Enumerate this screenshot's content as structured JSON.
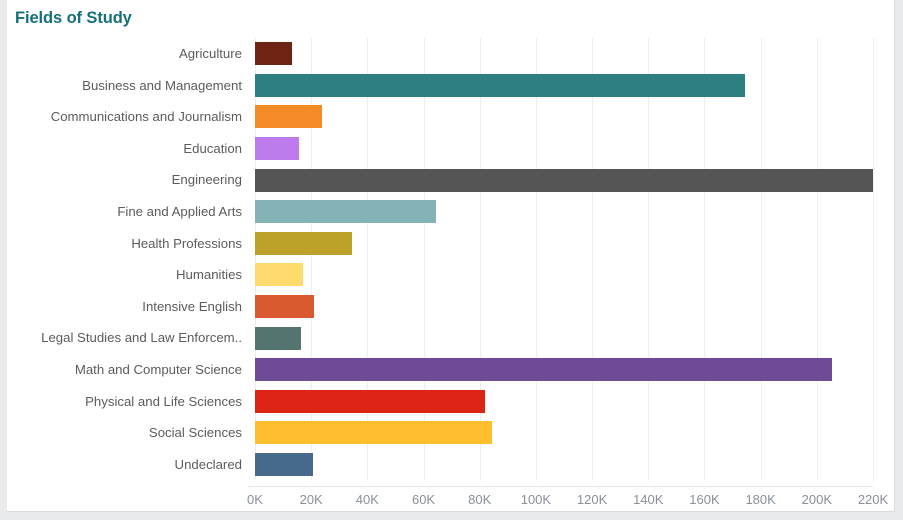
{
  "chart": {
    "title": "Fields of Study",
    "title_color": "#15707a",
    "background": "#ffffff",
    "page_background": "#e9eaec",
    "label_color": "#5c5c5c",
    "tick_color": "#8a9099",
    "gridline_color": "#eceded"
  },
  "chart_data": {
    "type": "bar",
    "orientation": "horizontal",
    "title": "Fields of Study",
    "xlabel": "",
    "ylabel": "",
    "xlim": [
      0,
      220000
    ],
    "xtick_labels": [
      "0K",
      "20K",
      "40K",
      "60K",
      "80K",
      "100K",
      "120K",
      "140K",
      "160K",
      "180K",
      "200K",
      "220K"
    ],
    "xtick_values": [
      0,
      20000,
      40000,
      60000,
      80000,
      100000,
      120000,
      140000,
      160000,
      180000,
      200000,
      220000
    ],
    "grid": true,
    "grid_axis": "x",
    "legend": false,
    "categories": [
      "Agriculture",
      "Business and Management",
      "Communications and Journalism",
      "Education",
      "Engineering",
      "Fine and Applied Arts",
      "Health Professions",
      "Humanities",
      "Intensive English",
      "Legal Studies and Law Enforcem..",
      "Math and Computer Science",
      "Physical and Life Sciences",
      "Social Sciences",
      "Undeclared"
    ],
    "values": [
      13000,
      174500,
      24000,
      15500,
      220000,
      64500,
      34500,
      17000,
      21000,
      16500,
      205500,
      82000,
      84500,
      20500
    ],
    "colors": [
      "#6d2413",
      "#2d7f82",
      "#f38b26",
      "#bd7beb",
      "#555555",
      "#85b2b6",
      "#bda028",
      "#ffdb6d",
      "#d95a30",
      "#54756f",
      "#6f4a95",
      "#dc2515",
      "#ffbe2e",
      "#47698c"
    ],
    "bars": [
      {
        "category": "Agriculture",
        "value": 13000,
        "color": "#6d2413"
      },
      {
        "category": "Business and Management",
        "value": 174500,
        "color": "#2d7f82"
      },
      {
        "category": "Communications and Journalism",
        "value": 24000,
        "color": "#f38b26"
      },
      {
        "category": "Education",
        "value": 15500,
        "color": "#bd7beb"
      },
      {
        "category": "Engineering",
        "value": 220000,
        "color": "#555555"
      },
      {
        "category": "Fine and Applied Arts",
        "value": 64500,
        "color": "#85b2b6"
      },
      {
        "category": "Health Professions",
        "value": 34500,
        "color": "#bda028"
      },
      {
        "category": "Humanities",
        "value": 17000,
        "color": "#ffdb6d"
      },
      {
        "category": "Intensive English",
        "value": 21000,
        "color": "#d95a30"
      },
      {
        "category": "Legal Studies and Law Enforcem..",
        "value": 16500,
        "color": "#54756f"
      },
      {
        "category": "Math and Computer Science",
        "value": 205500,
        "color": "#6f4a95"
      },
      {
        "category": "Physical and Life Sciences",
        "value": 82000,
        "color": "#dc2515"
      },
      {
        "category": "Social Sciences",
        "value": 84500,
        "color": "#ffbe2e"
      },
      {
        "category": "Undeclared",
        "value": 20500,
        "color": "#47698c"
      }
    ]
  }
}
